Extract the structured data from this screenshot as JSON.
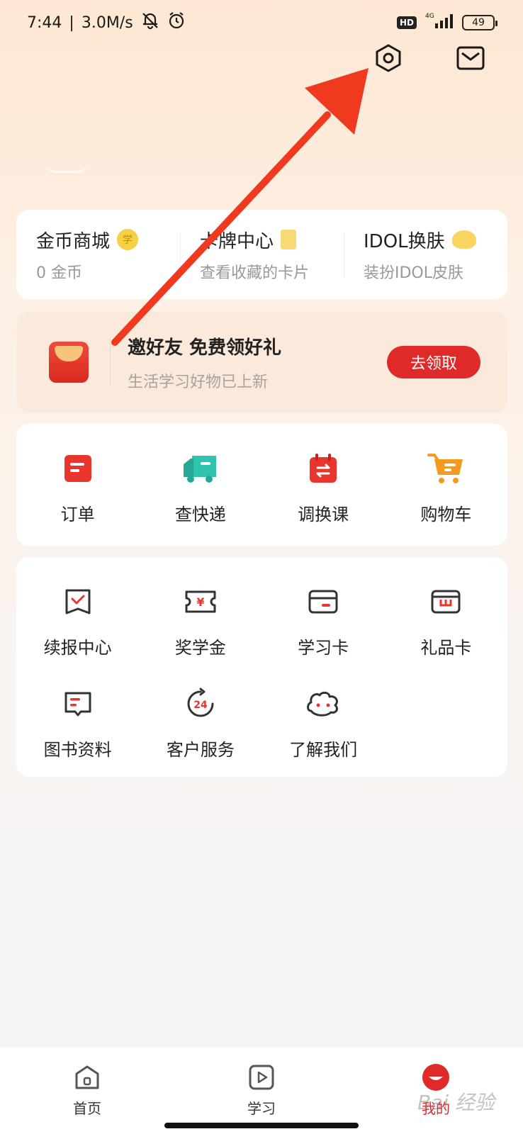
{
  "status_bar": {
    "time": "7:44",
    "speed": "3.0M/s",
    "hd": "HD",
    "network": "4G",
    "battery": "49"
  },
  "header": {
    "icons": [
      "settings-icon",
      "mail-icon"
    ]
  },
  "coin_card": {
    "items": [
      {
        "title": "金币商城",
        "sub": "0 金币",
        "badge": "学"
      },
      {
        "title": "卡牌中心",
        "sub": "查看收藏的卡片",
        "badge": ""
      },
      {
        "title": "IDOL换肤",
        "sub": "装扮IDOL皮肤",
        "badge": ""
      }
    ]
  },
  "invite": {
    "title": "邀好友 免费领好礼",
    "sub": "生活学习好物已上新",
    "button": "去领取"
  },
  "orders": {
    "items": [
      {
        "label": "订单",
        "icon": "order-icon",
        "color": "#e8352e"
      },
      {
        "label": "查快递",
        "icon": "truck-icon",
        "color": "#2ec4b0"
      },
      {
        "label": "调换课",
        "icon": "calendar-swap-icon",
        "color": "#e8352e"
      },
      {
        "label": "购物车",
        "icon": "cart-icon",
        "color": "#f39a1f"
      }
    ]
  },
  "services": {
    "items": [
      {
        "label": "续报中心",
        "icon": "renew-icon"
      },
      {
        "label": "奖学金",
        "icon": "scholarship-icon"
      },
      {
        "label": "学习卡",
        "icon": "study-card-icon"
      },
      {
        "label": "礼品卡",
        "icon": "gift-card-icon"
      },
      {
        "label": "图书资料",
        "icon": "book-icon"
      },
      {
        "label": "客户服务",
        "icon": "service-24-icon"
      },
      {
        "label": "了解我们",
        "icon": "mascot-icon"
      }
    ]
  },
  "bottom_nav": {
    "items": [
      {
        "label": "首页",
        "icon": "home-icon",
        "active": false
      },
      {
        "label": "学习",
        "icon": "play-icon",
        "active": false
      },
      {
        "label": "我的",
        "icon": "profile-icon",
        "active": true
      }
    ]
  },
  "watermark": "Bai 经验",
  "colors": {
    "accent": "#e02a2a",
    "arrow": "#f03a1f"
  }
}
